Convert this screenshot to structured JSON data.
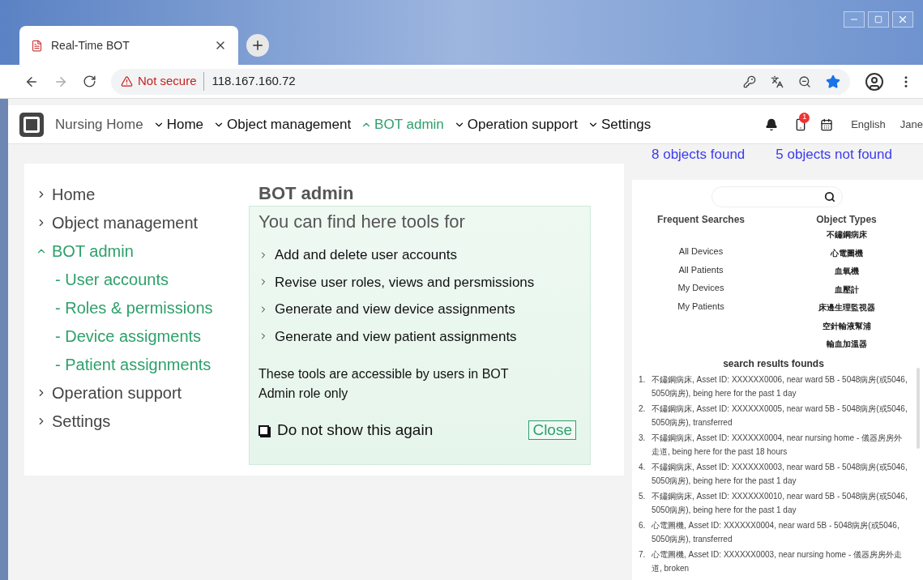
{
  "browser": {
    "tab_title": "Real-Time BOT",
    "security": "Not secure",
    "url": "118.167.160.72"
  },
  "app_nav": {
    "brand": "Nursing Home",
    "items": [
      {
        "label": "Home",
        "expanded": false,
        "selected": false
      },
      {
        "label": "Object management",
        "expanded": false,
        "selected": false
      },
      {
        "label": "BOT admin",
        "expanded": true,
        "selected": true
      },
      {
        "label": "Operation support",
        "expanded": false,
        "selected": false
      },
      {
        "label": "Settings",
        "expanded": false,
        "selected": false
      }
    ],
    "notification_count": "1",
    "language": "English",
    "user": "Jane"
  },
  "status": {
    "found": "8 objects found",
    "not_found": "5 objects not found"
  },
  "sidebar": {
    "items": [
      {
        "label": "Home",
        "expanded": false,
        "selected": false
      },
      {
        "label": "Object management",
        "expanded": false,
        "selected": false
      },
      {
        "label": "BOT admin",
        "expanded": true,
        "selected": true,
        "children": [
          {
            "label": "- User accounts"
          },
          {
            "label": "- Roles & permissions"
          },
          {
            "label": "- Device assigments"
          },
          {
            "label": "- Patient assignments"
          }
        ]
      },
      {
        "label": "Operation support",
        "expanded": false,
        "selected": false
      },
      {
        "label": "Settings",
        "expanded": false,
        "selected": false
      }
    ]
  },
  "dialog": {
    "title": "BOT admin",
    "heading": "You can find here tools for",
    "tools": [
      "Add and delete user accounts",
      "Revise user roles, views and persmissions",
      "Generate and view device assignments",
      "Generate and view patient assignments"
    ],
    "note": "These tools are accessible by users in BOT Admin role only",
    "dont_show": {
      "label": "Do not show this again",
      "checked": false
    },
    "close": "Close"
  },
  "search_panel": {
    "frequent_searches": {
      "title": "Frequent Searches",
      "items": [
        "All Devices",
        "All Patients",
        "My Devices",
        "My Patients"
      ]
    },
    "object_types": {
      "title": "Object Types",
      "items": [
        "不鏽鋼病床",
        "心電圖機",
        "血氧機",
        "血壓計",
        "床邊生理監視器",
        "空針輸液幫浦",
        "輸血加溫器"
      ]
    },
    "results": {
      "title": "search results founds",
      "items": [
        {
          "number": "1.",
          "text": "不鏽鋼病床, Asset ID: XXXXXX0006, near ward 5B - 5048病房(或5046, 5050病房), being here for the past 1 day"
        },
        {
          "number": "2.",
          "text": "不鏽鋼病床, Asset ID: XXXXXX0005, near ward 5B - 5048病房(或5046, 5050病房), transferred"
        },
        {
          "number": "3.",
          "text": "不鏽鋼病床, Asset ID: XXXXXX0004, near nursing home - 儀器房房外走道, being here for the past 18 hours"
        },
        {
          "number": "4.",
          "text": "不鏽鋼病床, Asset ID: XXXXXX0003, near ward 5B - 5048病房(或5046, 5050病房), being here for the past 1 day"
        },
        {
          "number": "5.",
          "text": "不鏽鋼病床, Asset ID: XXXXXX0010, near ward 5B - 5048病房(或5046, 5050病房), being here for the past 1 day"
        },
        {
          "number": "6.",
          "text": "心電圖機, Asset ID: XXXXXX0004, near ward 5B - 5048病房(或5046, 5050病房), transferred"
        },
        {
          "number": "7.",
          "text": "心電圖機, Asset ID: XXXXXX0003, near nursing home - 儀器房房外走道, broken"
        }
      ]
    }
  }
}
